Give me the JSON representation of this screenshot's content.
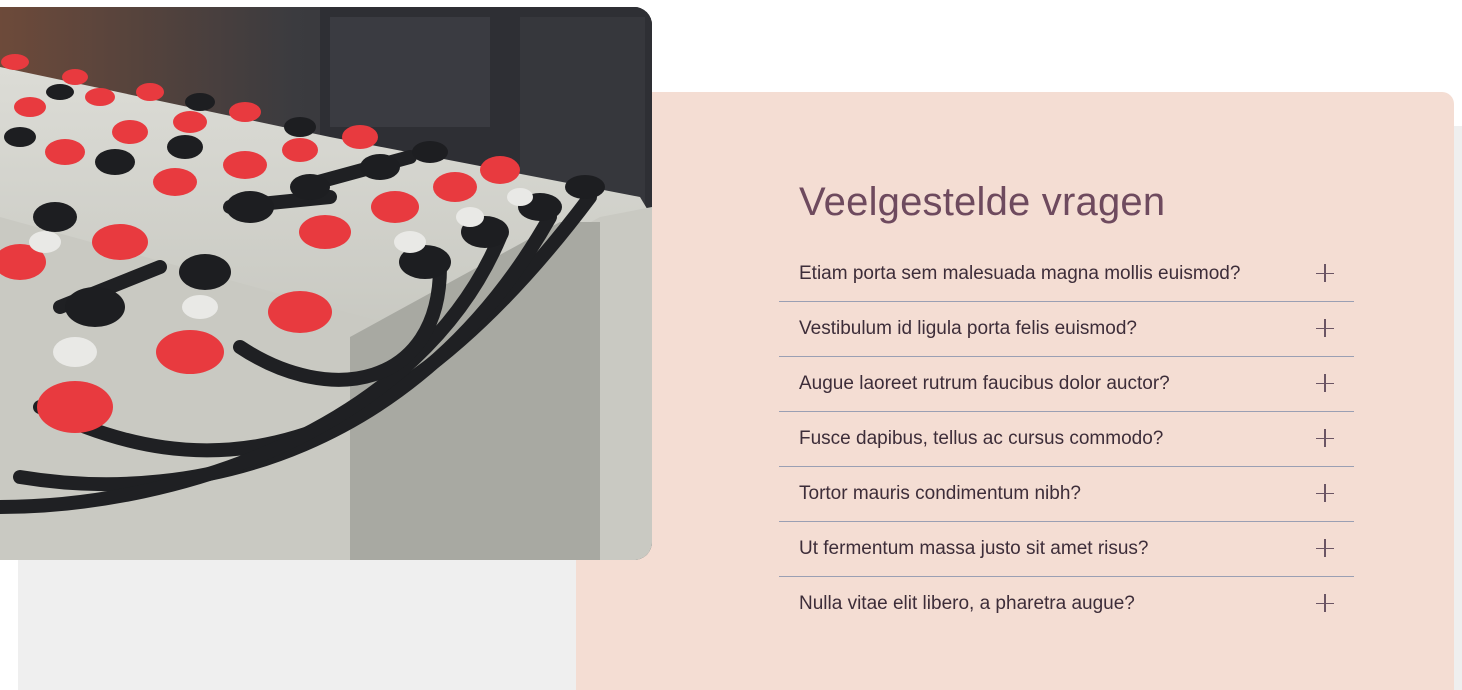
{
  "faq": {
    "title": "Veelgestelde vragen",
    "items": [
      {
        "question": "Etiam porta sem malesuada magna mollis euismod?",
        "icon": "plus-icon"
      },
      {
        "question": "Vestibulum id ligula porta felis euismod?",
        "icon": "plus-icon"
      },
      {
        "question": "Augue laoreet rutrum faucibus dolor auctor?",
        "icon": "plus-icon"
      },
      {
        "question": "Fusce dapibus, tellus ac cursus commodo?",
        "icon": "plus-icon"
      },
      {
        "question": "Tortor mauris condimentum nibh?",
        "icon": "plus-icon"
      },
      {
        "question": "Ut fermentum massa justo sit amet risus?",
        "icon": "plus-icon"
      },
      {
        "question": "Nulla vitae elit libero, a pharetra augue?",
        "icon": "plus-icon"
      }
    ]
  },
  "colors": {
    "card_background": "#f4ddd3",
    "band_background": "#efefef",
    "title": "#6e4a5e",
    "question_text": "#3d2d39",
    "divider": "#9a9fb3"
  },
  "image": {
    "subject": "battery bank with red and black terminal caps"
  }
}
